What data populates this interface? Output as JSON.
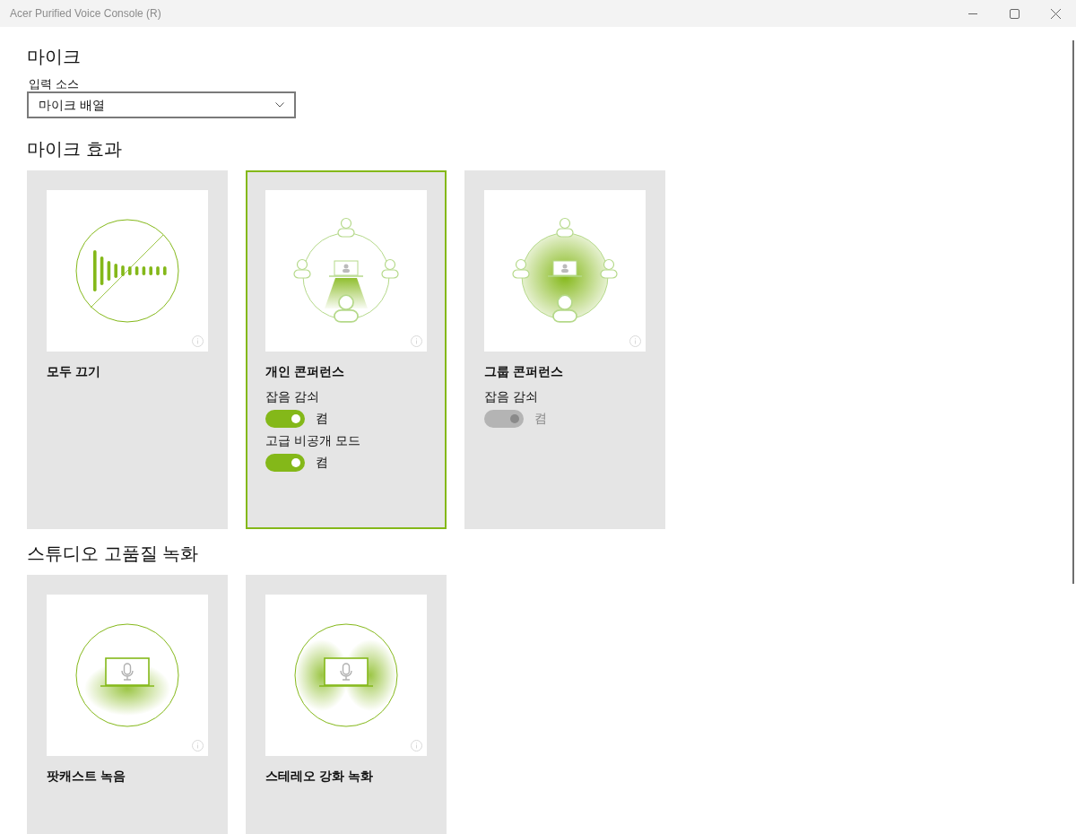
{
  "window": {
    "title": "Acer Purified Voice Console (R)"
  },
  "sections": [
    {
      "heading": "마이크",
      "input_source": {
        "label": "입력 소스",
        "value": "마이크 배열"
      }
    },
    {
      "heading": "마이크 효과",
      "cards": [
        {
          "kind": "mute",
          "title": "모두 끄기",
          "selected": false
        },
        {
          "kind": "personal",
          "title": "개인 콘퍼런스",
          "selected": true,
          "toggles": [
            {
              "label": "잡음 감쇠",
              "on": true,
              "disabled": false,
              "state_text": "켬"
            },
            {
              "label": "고급 비공개 모드",
              "on": true,
              "disabled": false,
              "state_text": "켬"
            }
          ]
        },
        {
          "kind": "group",
          "title": "그룹 콘퍼런스",
          "selected": false,
          "toggles": [
            {
              "label": "잡음 감쇠",
              "on": true,
              "disabled": true,
              "state_text": "켬"
            }
          ]
        }
      ]
    },
    {
      "heading": "스튜디오 고품질 녹화",
      "cards": [
        {
          "kind": "podcast",
          "title": "팟캐스트 녹음",
          "selected": false
        },
        {
          "kind": "stereo",
          "title": "스테레오 강화 녹화",
          "selected": false
        }
      ]
    }
  ]
}
